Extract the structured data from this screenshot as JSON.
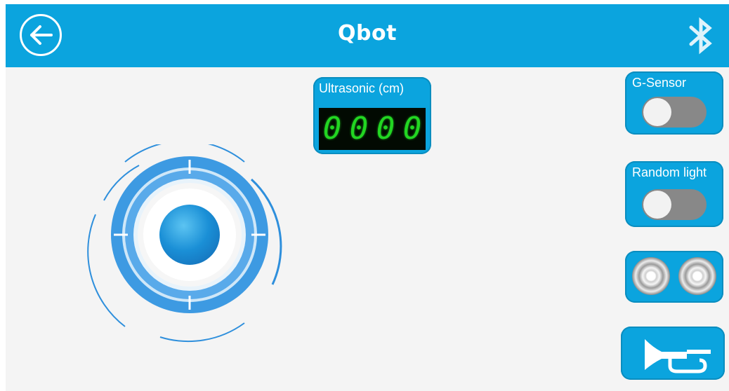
{
  "app": {
    "title": "Qbot"
  },
  "topbar": {
    "back_icon": "arrow-left-icon",
    "bluetooth_icon": "bluetooth-icon"
  },
  "ultrasonic": {
    "label": "Ultrasonic (cm)",
    "digits": [
      "0",
      "0",
      "0",
      "0"
    ]
  },
  "controls": {
    "g_sensor": {
      "label": "G-Sensor",
      "state": "off"
    },
    "random_light": {
      "label": "Random light",
      "state": "off"
    },
    "lights": {
      "icon": "light-bulb-icon"
    },
    "horn": {
      "icon": "horn-icon"
    }
  },
  "colors": {
    "brand": "#0ba4de",
    "segment_on": "#22d622",
    "toggle_off": "#888888"
  }
}
